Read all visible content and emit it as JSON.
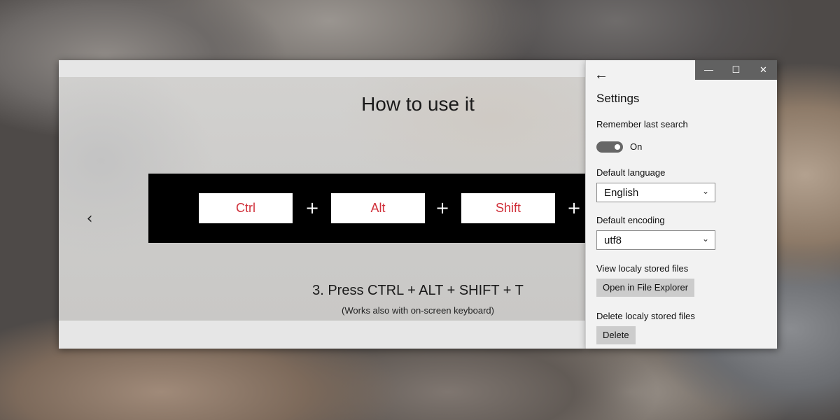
{
  "main_window": {
    "title": "How to use it",
    "keys": [
      "Ctrl",
      "Alt",
      "Shift"
    ],
    "plus": "+",
    "prev_glyph": "‹",
    "step_text": "3. Press CTRL + ALT + SHIFT + T",
    "step_sub": "(Works also with on-screen keyboard)"
  },
  "settings": {
    "back_glyph": "←",
    "window_controls": {
      "minimize": "—",
      "maximize": "☐",
      "close": "✕"
    },
    "heading": "Settings",
    "remember_label": "Remember last search",
    "remember_toggle": {
      "state": "On",
      "on": true
    },
    "language_label": "Default language",
    "language_value": "English",
    "encoding_label": "Default encoding",
    "encoding_value": "utf8",
    "view_files_label": "View localy stored files",
    "open_explorer_button": "Open in File Explorer",
    "delete_files_label": "Delete localy stored files",
    "delete_button": "Delete"
  },
  "colors": {
    "key_text": "#d0303a",
    "key_strip": "#000000",
    "window_controls_bg": "#616161",
    "toggle_on": "#666666"
  },
  "icons": {
    "prev": "chevron-left-icon",
    "back": "back-arrow-icon",
    "dropdown": "chevron-down-icon"
  }
}
